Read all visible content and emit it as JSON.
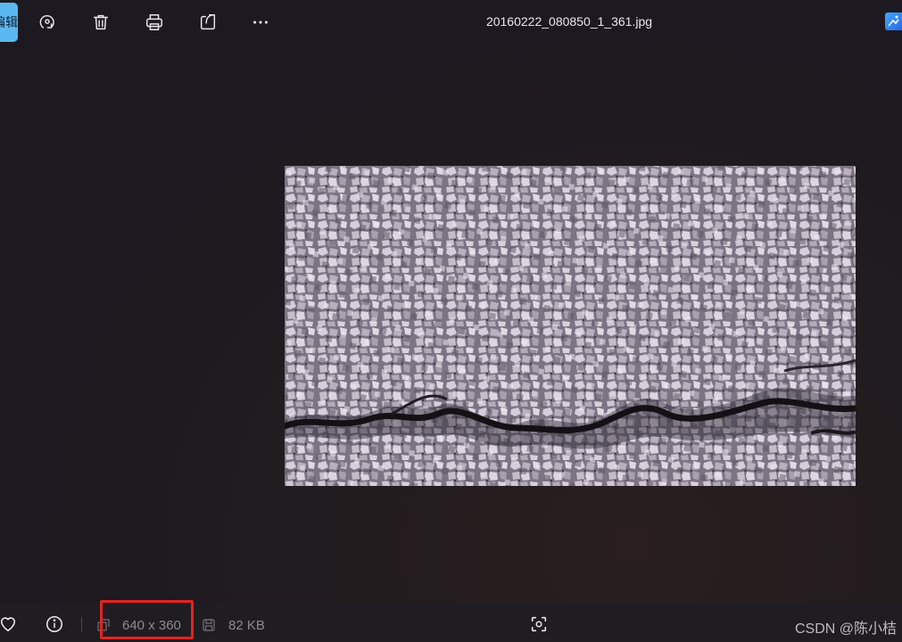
{
  "toolbar": {
    "edit_label": "编辑",
    "rotate_icon": "rotate-icon",
    "delete_icon": "trash-icon",
    "print_icon": "printer-icon",
    "share_icon": "share-icon",
    "more_icon": "more-icon"
  },
  "file": {
    "name": "20160222_080850_1_361.jpg"
  },
  "image": {
    "alt": "pavement crack photo"
  },
  "status": {
    "dimensions": "640 x 360",
    "file_size": "82 KB",
    "favorite_icon": "heart-icon",
    "info_icon": "info-icon",
    "dimensions_icon": "image-size-icon",
    "size_icon": "disk-icon",
    "focus_icon": "focus-icon"
  },
  "watermark": "CSDN @陈小桔",
  "colors": {
    "accent": "#5cb8f0",
    "background": "#1c1a20",
    "highlight": "#e42320"
  }
}
